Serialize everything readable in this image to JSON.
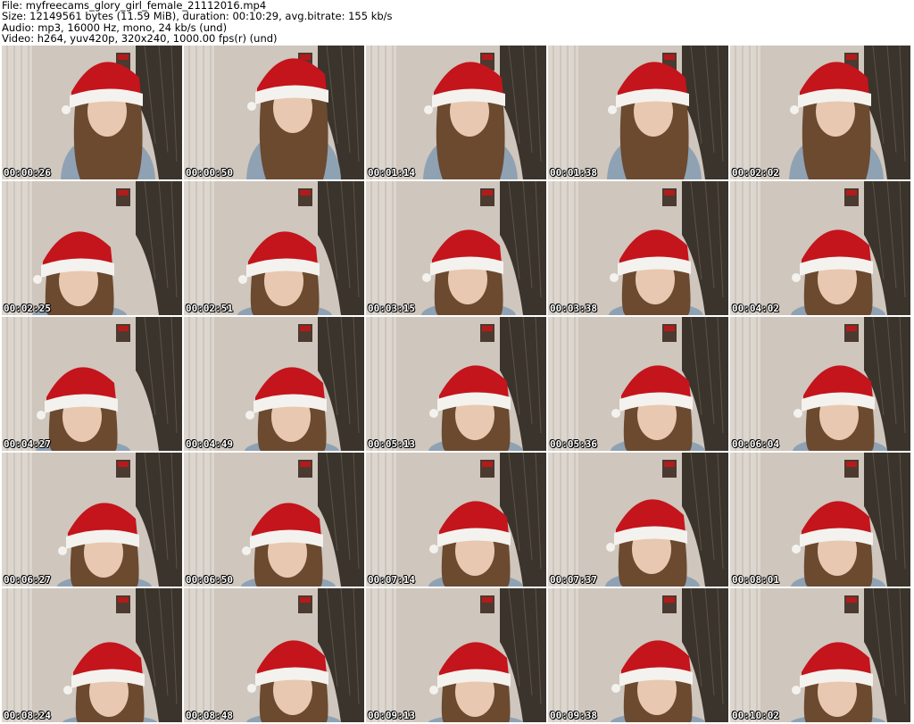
{
  "header": {
    "file_line": "File: myfreecams_glory_girl_female_21112016.mp4",
    "size_line": "Size: 12149561 bytes (11.59 MiB), duration: 00:10:29, avg.bitrate: 155 kb/s",
    "audio_line": "Audio: mp3, 16000 Hz, mono, 24 kb/s (und)",
    "video_line": "Video: h264, yuv420p, 320x240, 1000.00 fps(r) (und)"
  },
  "thumbnails": [
    {
      "timestamp": "00:00:26"
    },
    {
      "timestamp": "00:00:50"
    },
    {
      "timestamp": "00:01:14"
    },
    {
      "timestamp": "00:01:38"
    },
    {
      "timestamp": "00:02:02"
    },
    {
      "timestamp": "00:02:25"
    },
    {
      "timestamp": "00:02:51"
    },
    {
      "timestamp": "00:03:15"
    },
    {
      "timestamp": "00:03:38"
    },
    {
      "timestamp": "00:04:02"
    },
    {
      "timestamp": "00:04:27"
    },
    {
      "timestamp": "00:04:49"
    },
    {
      "timestamp": "00:05:13"
    },
    {
      "timestamp": "00:05:36"
    },
    {
      "timestamp": "00:06:04"
    },
    {
      "timestamp": "00:06:27"
    },
    {
      "timestamp": "00:06:50"
    },
    {
      "timestamp": "00:07:14"
    },
    {
      "timestamp": "00:07:37"
    },
    {
      "timestamp": "00:08:01"
    },
    {
      "timestamp": "00:08:24"
    },
    {
      "timestamp": "00:08:48"
    },
    {
      "timestamp": "00:09:13"
    },
    {
      "timestamp": "00:09:38"
    },
    {
      "timestamp": "00:10:02"
    }
  ],
  "colors": {
    "background": "#ffffff",
    "wall": "#cfc6bd",
    "curtain": "#3a342c",
    "hat_red": "#c4141c",
    "hat_fur": "#f4f2ee",
    "hair": "#6b4a30",
    "sweater": "#8fa2b4",
    "skin": "#e8c8b0"
  }
}
